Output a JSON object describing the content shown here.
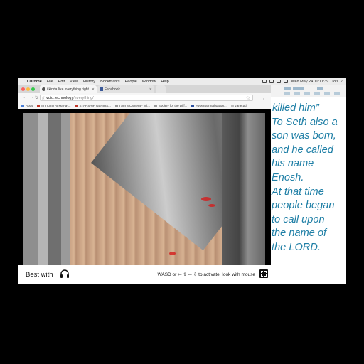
{
  "menubar": {
    "app": "Chrome",
    "items": [
      "File",
      "Edit",
      "View",
      "History",
      "Bookmarks",
      "People",
      "Window",
      "Help"
    ],
    "clock": "Wed May 24  11:11:39",
    "user": "Toti"
  },
  "tabs": [
    {
      "title": "i kinda like everything right",
      "active": true
    },
    {
      "title": "Facebook",
      "active": false
    }
  ],
  "address": {
    "host": "void.technology",
    "path": "/everything/"
  },
  "bookmarks": [
    "Apps",
    "In Trump At Mar-a-...",
    "STARSHIP GENIUS...",
    "I Am a Camera - Wi...",
    "Society for the Diff...",
    "HyperNormalisation...",
    "zane.pdf"
  ],
  "page": {
    "best_with": "Best with",
    "hint": "WASD or ⇦ ⇧ ⇨ ⇩ to activate, look with mouse"
  },
  "document": {
    "lines": [
      "killed him”",
      "To Seth also a",
      "son was born,",
      "and he called",
      "his name",
      "Enosh.",
      "At that time",
      "people began",
      "to call upon",
      "the name of",
      "the LORD."
    ]
  },
  "colors": {
    "doc_text": "#1f7fa6",
    "close": "#fc605b",
    "minimize": "#fdbc40",
    "zoom": "#34c84a"
  }
}
